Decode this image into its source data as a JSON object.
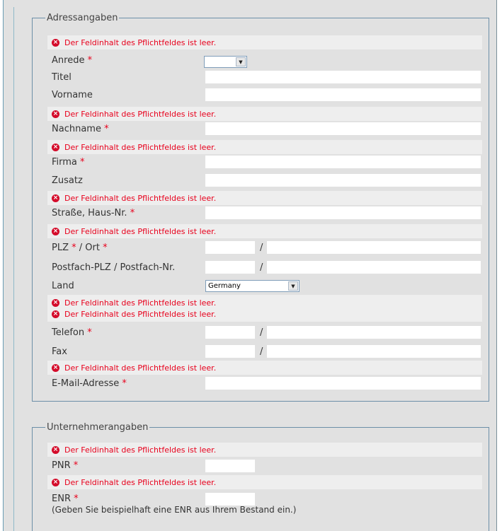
{
  "error_text": "Der Feldinhalt des Pflichtfeldes ist leer.",
  "required_mark": "*",
  "address": {
    "legend": "Adressangaben",
    "anrede_label": "Anrede",
    "anrede_value": "",
    "titel_label": "Titel",
    "vorname_label": "Vorname",
    "nachname_label": "Nachname",
    "firma_label": "Firma",
    "zusatz_label": "Zusatz",
    "strasse_label": "Straße, Haus-Nr.",
    "plz_label": "PLZ",
    "ort_label": "/ Ort",
    "postfach_label": "Postfach-PLZ / Postfach-Nr.",
    "land_label": "Land",
    "land_value": "Germany",
    "telefon_label": "Telefon",
    "fax_label": "Fax",
    "email_label": "E-Mail-Adresse",
    "slash": "/"
  },
  "company": {
    "legend": "Unternehmerangaben",
    "pnr_label": "PNR",
    "enr_label": "ENR",
    "enr_hint": "(Geben Sie beispielhaft eine ENR aus Ihrem Bestand ein.)"
  },
  "colors": {
    "error": "#e8001c",
    "background": "#e1e1e1",
    "fieldset_border": "#6d8fa8"
  },
  "icons": {
    "error": "error-circle-x-icon",
    "dropdown": "dropdown-arrow-icon"
  }
}
